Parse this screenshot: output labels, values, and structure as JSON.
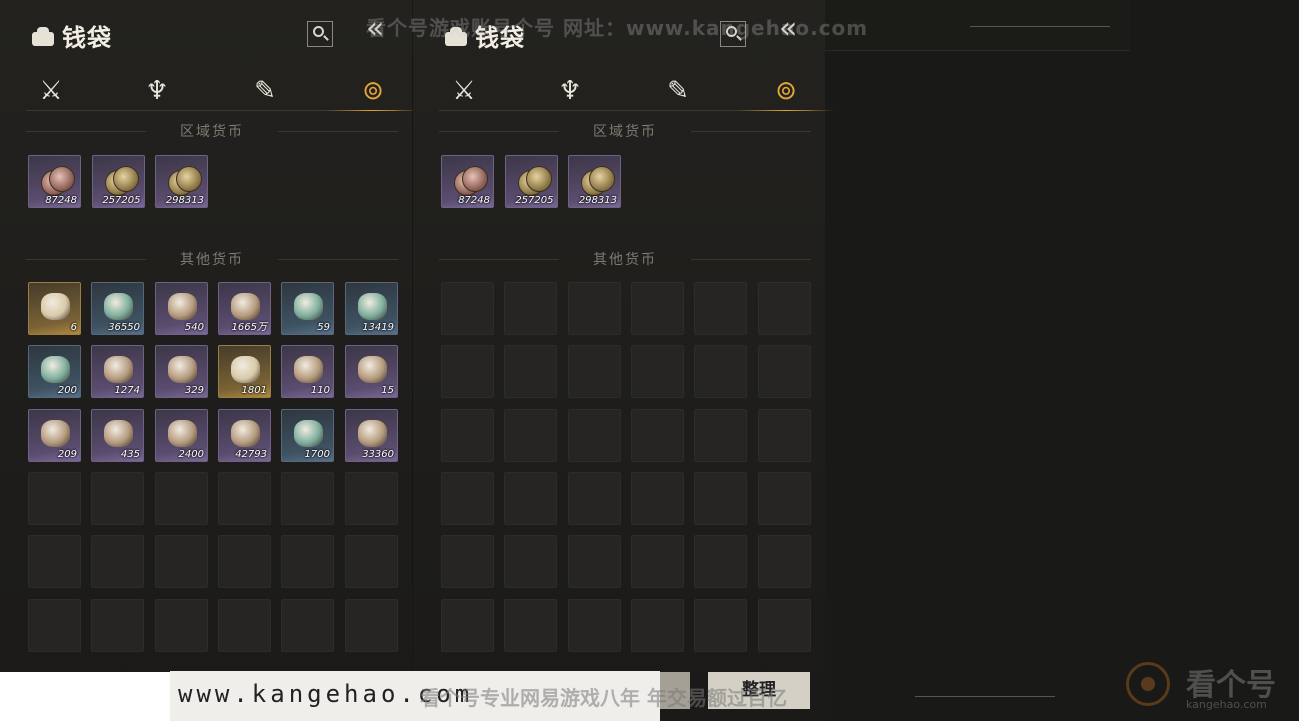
{
  "title": "钱袋",
  "tabs": [
    {
      "icon": "crossed-swords-icon",
      "glyph": "⚔"
    },
    {
      "icon": "pouch-icon",
      "glyph": "♆"
    },
    {
      "icon": "scroll-icon",
      "glyph": "✎"
    },
    {
      "icon": "coin-stack-icon",
      "glyph": "⊚",
      "active": true
    }
  ],
  "sections": {
    "regional": "区域货币",
    "other": "其他货币"
  },
  "regional_items": [
    {
      "name": "copper-coins",
      "qty": "87248",
      "coin": "red"
    },
    {
      "name": "bronze-coins",
      "qty": "257205",
      "coin": "gold"
    },
    {
      "name": "gold-coins",
      "qty": "298313",
      "coin": "gold"
    }
  ],
  "other_items": [
    {
      "name": "pearl-icon",
      "qty": "6",
      "rarity": "gold"
    },
    {
      "name": "jade-slip-icon",
      "qty": "36550",
      "rarity": "blue"
    },
    {
      "name": "jade-token-icon",
      "qty": "540",
      "rarity": "purple"
    },
    {
      "name": "bead-bracelet-icon",
      "qty": "1665万",
      "rarity": "purple"
    },
    {
      "name": "fish-icon",
      "qty": "59",
      "rarity": "blue"
    },
    {
      "name": "ancient-coin-icon",
      "qty": "13419",
      "rarity": "blue"
    },
    {
      "name": "dragon-icon",
      "qty": "200",
      "rarity": "blue"
    },
    {
      "name": "dark-crystal-icon",
      "qty": "1274",
      "rarity": "purple"
    },
    {
      "name": "jade-disc-icon",
      "qty": "329",
      "rarity": "purple"
    },
    {
      "name": "jade-ring-icon",
      "qty": "1801",
      "rarity": "gold"
    },
    {
      "name": "bamboo-slips-icon",
      "qty": "110",
      "rarity": "purple"
    },
    {
      "name": "crescent-moon-icon",
      "qty": "15",
      "rarity": "purple"
    },
    {
      "name": "stone-tablet-icon",
      "qty": "209",
      "rarity": "purple"
    },
    {
      "name": "red-orb-icon",
      "qty": "435",
      "rarity": "purple"
    },
    {
      "name": "green-shard-icon",
      "qty": "2400",
      "rarity": "purple"
    },
    {
      "name": "chain-key-icon",
      "qty": "42793",
      "rarity": "purple"
    },
    {
      "name": "gold-ingot-icon",
      "qty": "1700",
      "rarity": "blue"
    },
    {
      "name": "bronze-bowl-icon",
      "qty": "33360",
      "rarity": "purple"
    }
  ],
  "sort_button": "整理",
  "watermark_top": "看个号游戏账号个号   网址：www.kangehao.com",
  "watermark_bottom": "看个号专业网易游戏八年 年交易额过百亿",
  "url_bar": "www.kangehao.com",
  "brand": {
    "name": "看个号",
    "sub": "kangehao.com"
  },
  "colors": {
    "active_tab": "#e2a53a",
    "purple_rarity": "#5a4c6e",
    "blue_rarity": "#3e5262",
    "gold_rarity": "#7a6236"
  }
}
